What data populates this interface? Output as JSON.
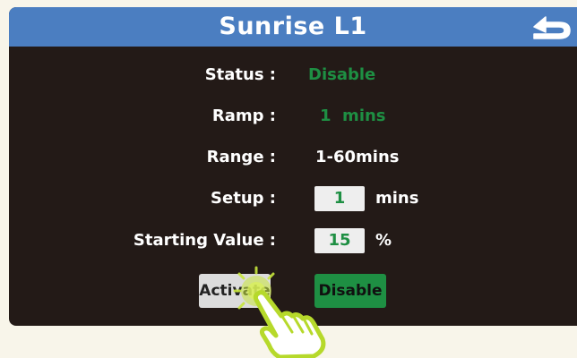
{
  "header": {
    "title": "Sunrise L1",
    "back_icon": "return-arrow-icon"
  },
  "rows": {
    "status": {
      "label": "Status :",
      "value": "Disable"
    },
    "ramp": {
      "label": "Ramp :",
      "value": "1  mins"
    },
    "range": {
      "label": "Range :",
      "value": "1-60mins"
    },
    "setup": {
      "label": "Setup :",
      "value": "1",
      "unit": "mins"
    },
    "starting": {
      "label": "Starting Value :",
      "value": "15",
      "unit": "%"
    }
  },
  "buttons": {
    "activate": "Activate",
    "disable": "Disable"
  },
  "colors": {
    "header": "#4b7ec1",
    "panel": "#231a17",
    "accent_green": "#1e8f43",
    "pointer_highlight": "#c8e63c"
  },
  "overlay": {
    "icon": "tap-hand-icon"
  }
}
